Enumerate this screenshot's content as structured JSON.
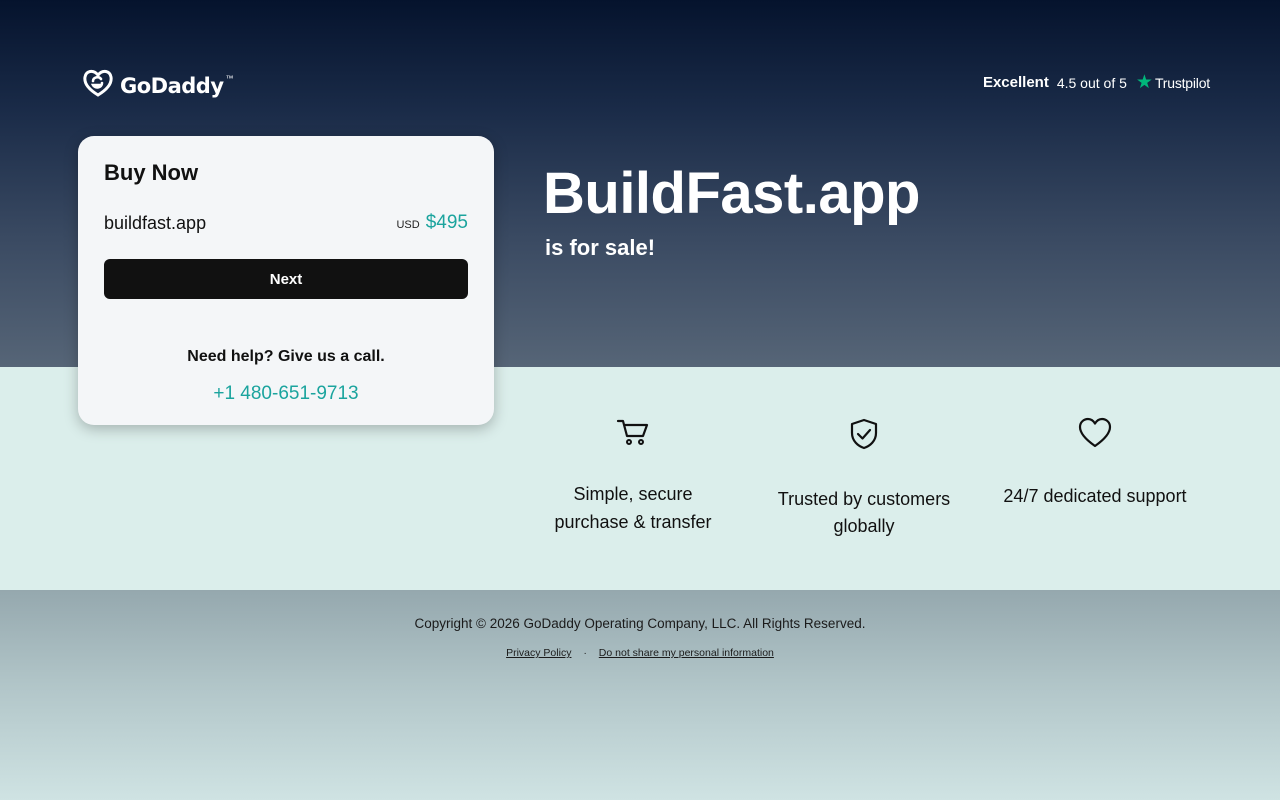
{
  "header": {
    "brand": "GoDaddy",
    "trademark": "™",
    "trustpilot": {
      "rating_word": "Excellent",
      "score_text": "4.5 out of 5",
      "brand": "Trustpilot",
      "star_color": "#00b67a"
    }
  },
  "card": {
    "title": "Buy Now",
    "domain": "buildfast.app",
    "currency": "USD",
    "price": "$495",
    "next_label": "Next",
    "help_text": "Need help? Give us a call.",
    "phone": "+1 480-651-9713"
  },
  "hero": {
    "domain": "BuildFast.app",
    "subtitle": "is for sale!"
  },
  "features": [
    {
      "icon": "cart-icon",
      "label_line1": "Simple, secure",
      "label_line2": "purchase & transfer"
    },
    {
      "icon": "shield-check-icon",
      "label_line1": "Trusted by customers",
      "label_line2": "globally"
    },
    {
      "icon": "heart-icon",
      "label_line1": "24/7 dedicated support"
    }
  ],
  "footer": {
    "copyright": "Copyright © 2026 GoDaddy Operating Company, LLC. All Rights Reserved.",
    "privacy_label": "Privacy Policy",
    "separator": "·",
    "do_not_share_label": "Do not share my personal information"
  },
  "colors": {
    "accent_teal": "#1ba49e",
    "button_dark": "#111111",
    "hero_top": "#05132d",
    "band_light": "#dbeeeb"
  }
}
